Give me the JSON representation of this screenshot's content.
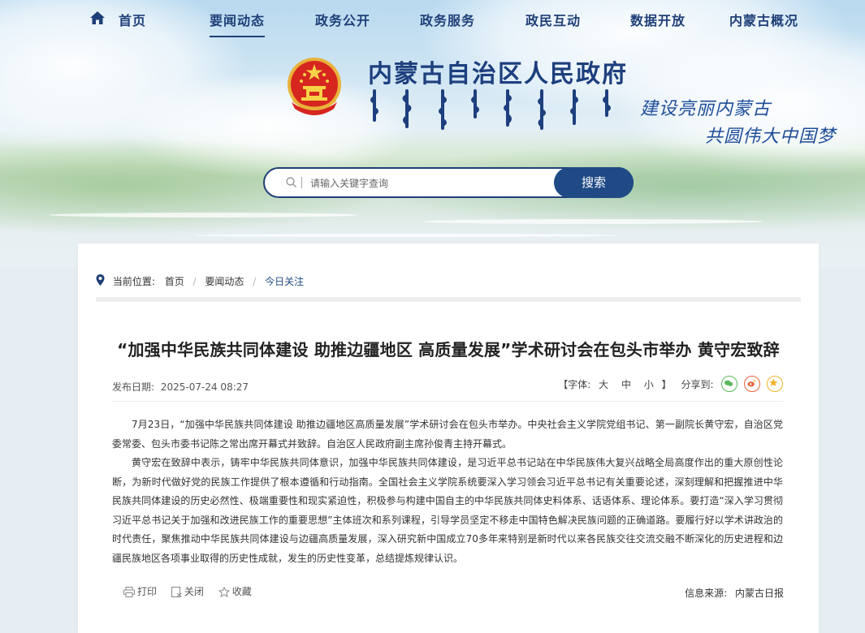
{
  "nav": {
    "items": [
      {
        "label": "首页"
      },
      {
        "label": "要闻动态"
      },
      {
        "label": "政务公开"
      },
      {
        "label": "政务服务"
      },
      {
        "label": "政民互动"
      },
      {
        "label": "数据开放"
      },
      {
        "label": "内蒙古概况"
      }
    ],
    "active": "要闻动态"
  },
  "header": {
    "title": "内蒙古自治区人民政府",
    "slogan_line1": "建设亮丽内蒙古",
    "slogan_line2": "共圆伟大中国梦"
  },
  "search": {
    "placeholder": "请输入关键字查询",
    "button_label": "搜索"
  },
  "breadcrumb": {
    "label": "当前位置:",
    "items": [
      "首页",
      "要闻动态",
      "今日关注"
    ]
  },
  "article": {
    "title": "“加强中华民族共同体建设 助推边疆地区 高质量发展”学术研讨会在包头市举办 黄守宏致辞",
    "date_label": "发布日期:",
    "date": "2025-07-24 08:27",
    "font_label": "【字体:",
    "font_sizes": [
      "大",
      "中",
      "小"
    ],
    "font_close": "】",
    "share_label": "分享到:",
    "paragraphs": [
      "7月23日，“加强中华民族共同体建设 助推边疆地区高质量发展”学术研讨会在包头市举办。中央社会主义学院党组书记、第一副院长黄守宏，自治区党委常委、包头市委书记陈之常出席开幕式并致辞。自治区人民政府副主席孙俊青主持开幕式。",
      "黄守宏在致辞中表示，铸牢中华民族共同体意识，加强中华民族共同体建设，是习近平总书记站在中华民族伟大复兴战略全局高度作出的重大原创性论断，为新时代做好党的民族工作提供了根本遵循和行动指南。全国社会主义学院系统要深入学习领会习近平总书记有关重要论述，深刻理解和把握推进中华民族共同体建设的历史必然性、极端重要性和现实紧迫性，积极参与构建中国自主的中华民族共同体史料体系、话语体系、理论体系。要打造“深入学习贯彻习近平总书记关于加强和改进民族工作的重要思想”主体班次和系列课程，引导学员坚定不移走中国特色解决民族问题的正确道路。要履行好以学术讲政治的时代责任，聚焦推动中华民族共同体建设与边疆高质量发展，深入研究新中国成立70多年来特别是新时代以来各民族交往交流交融不断深化的历史进程和边疆民族地区各项事业取得的历史性成就，发生的历史性变革，总结提炼规律认识。"
    ]
  },
  "footer": {
    "print_label": "打印",
    "close_label": "关闭",
    "favorite_label": "收藏",
    "source_label": "信息来源:",
    "source": "内蒙古日报"
  },
  "colors": {
    "brand_blue": "#1f3f78",
    "button_blue": "#1f4a85",
    "wechat": "#5cb85c",
    "weibo": "#e8633a",
    "qzone": "#f0b42a"
  }
}
